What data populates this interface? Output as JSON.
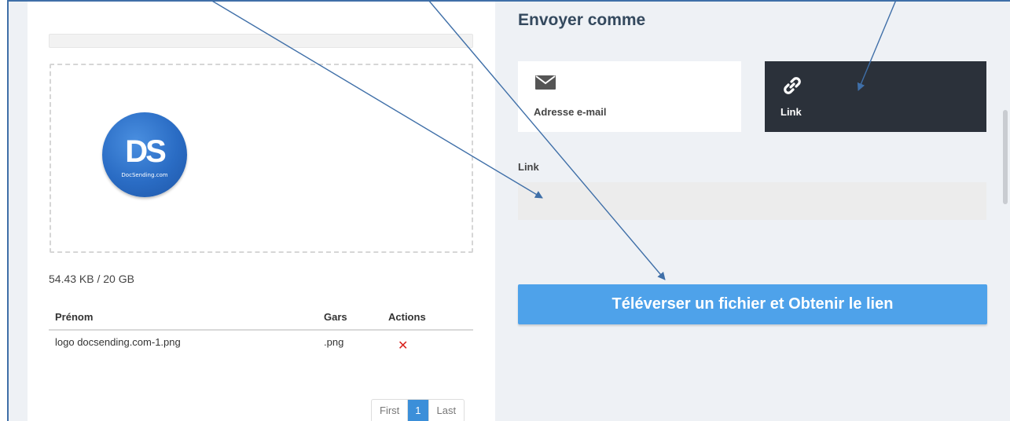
{
  "upload": {
    "quota_text": "54.43 KB / 20 GB",
    "logo_text": "DS",
    "logo_subtext": "DocSending.com"
  },
  "file_table": {
    "headers": {
      "name": "Prénom",
      "type": "Gars",
      "actions": "Actions"
    },
    "rows": [
      {
        "name": "logo docsending.com-1.png",
        "type": ".png",
        "action_icon": "close-icon"
      }
    ]
  },
  "pagination": {
    "first": "First",
    "current": "1",
    "last": "Last"
  },
  "send_as": {
    "title": "Envoyer comme",
    "options": [
      {
        "label": "Adresse e-mail",
        "icon": "envelope-icon",
        "selected": false
      },
      {
        "label": "Link",
        "icon": "link-icon",
        "selected": true
      }
    ]
  },
  "link_field": {
    "label": "Link",
    "value": "",
    "placeholder": ""
  },
  "upload_button": {
    "label": "Téléverser un fichier et Obtenir le lien"
  },
  "colors": {
    "primary_button": "#4ea2ea",
    "selected_card": "#2b313a",
    "panel_bg": "#eef1f5",
    "delete": "#d9231e",
    "annotation": "#3f6fa8"
  }
}
